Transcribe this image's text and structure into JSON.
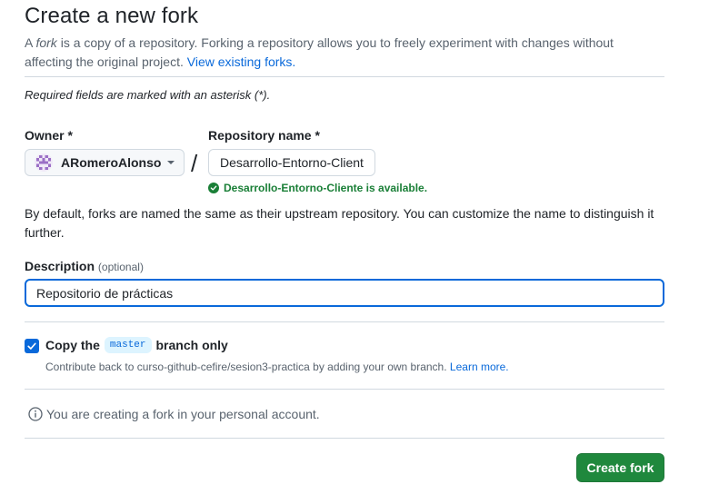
{
  "header": {
    "title": "Create a new fork",
    "subtitle_prefix": "A ",
    "subtitle_em": "fork",
    "subtitle_rest": " is a copy of a repository. Forking a repository allows you to freely experiment with changes without affecting the original project. ",
    "view_forks_link": "View existing forks."
  },
  "required_note": "Required fields are marked with an asterisk (*).",
  "owner": {
    "label": "Owner *",
    "selected": "ARomeroAlonso"
  },
  "separator": "/",
  "repository": {
    "label": "Repository name *",
    "value": "Desarrollo-Entorno-Cliente",
    "availability": "Desarrollo-Entorno-Cliente is available.",
    "status_color": "#1a7f37"
  },
  "default_note": "By default, forks are named the same as their upstream repository. You can customize the name to distinguish it further.",
  "description": {
    "label": "Description",
    "optional": "(optional)",
    "value": "Repositorio de prácticas"
  },
  "copy_branch": {
    "checked": true,
    "label_prefix": "Copy the",
    "branch": "master",
    "label_suffix": "branch only",
    "help_text": "Contribute back to curso-github-cefire/sesion3-practica by adding your own branch.",
    "learn_more": "Learn more."
  },
  "info_text": "You are creating a fork in your personal account.",
  "create_button": "Create fork",
  "colors": {
    "accent": "#0969da",
    "primary_button": "#1f883d",
    "muted_text": "#59636e",
    "border": "#d1d9e0"
  }
}
